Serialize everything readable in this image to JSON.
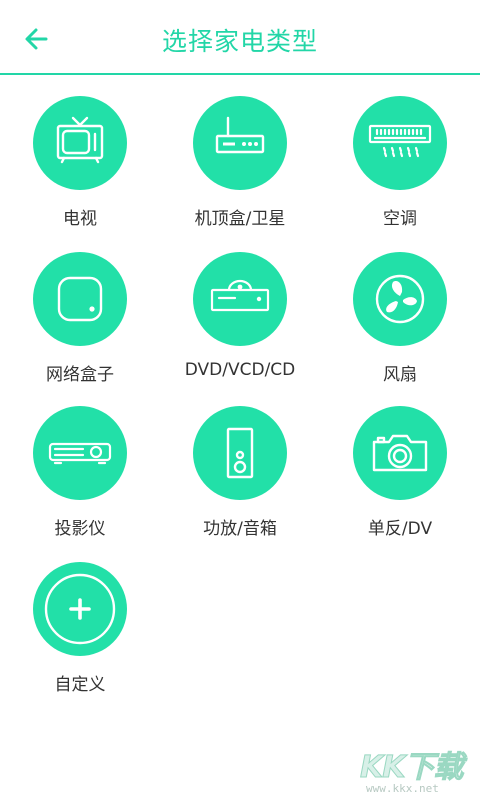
{
  "header": {
    "title": "选择家电类型",
    "back_icon": "arrow-left-icon",
    "accent_color": "#22d6a7"
  },
  "devices": [
    {
      "label": "电视",
      "icon": "tv-icon"
    },
    {
      "label": "机顶盒/卫星",
      "icon": "set-top-box-icon"
    },
    {
      "label": "空调",
      "icon": "air-conditioner-icon"
    },
    {
      "label": "网络盒子",
      "icon": "network-box-icon"
    },
    {
      "label": "DVD/VCD/CD",
      "icon": "dvd-player-icon"
    },
    {
      "label": "风扇",
      "icon": "fan-icon"
    },
    {
      "label": "投影仪",
      "icon": "projector-icon"
    },
    {
      "label": "功放/音箱",
      "icon": "speaker-icon"
    },
    {
      "label": "单反/DV",
      "icon": "camera-icon"
    },
    {
      "label": "自定义",
      "icon": "add-icon"
    }
  ],
  "circle_color": "#22e0a8",
  "watermark": {
    "logo": "KK下载",
    "url": "www.kkx.net"
  }
}
